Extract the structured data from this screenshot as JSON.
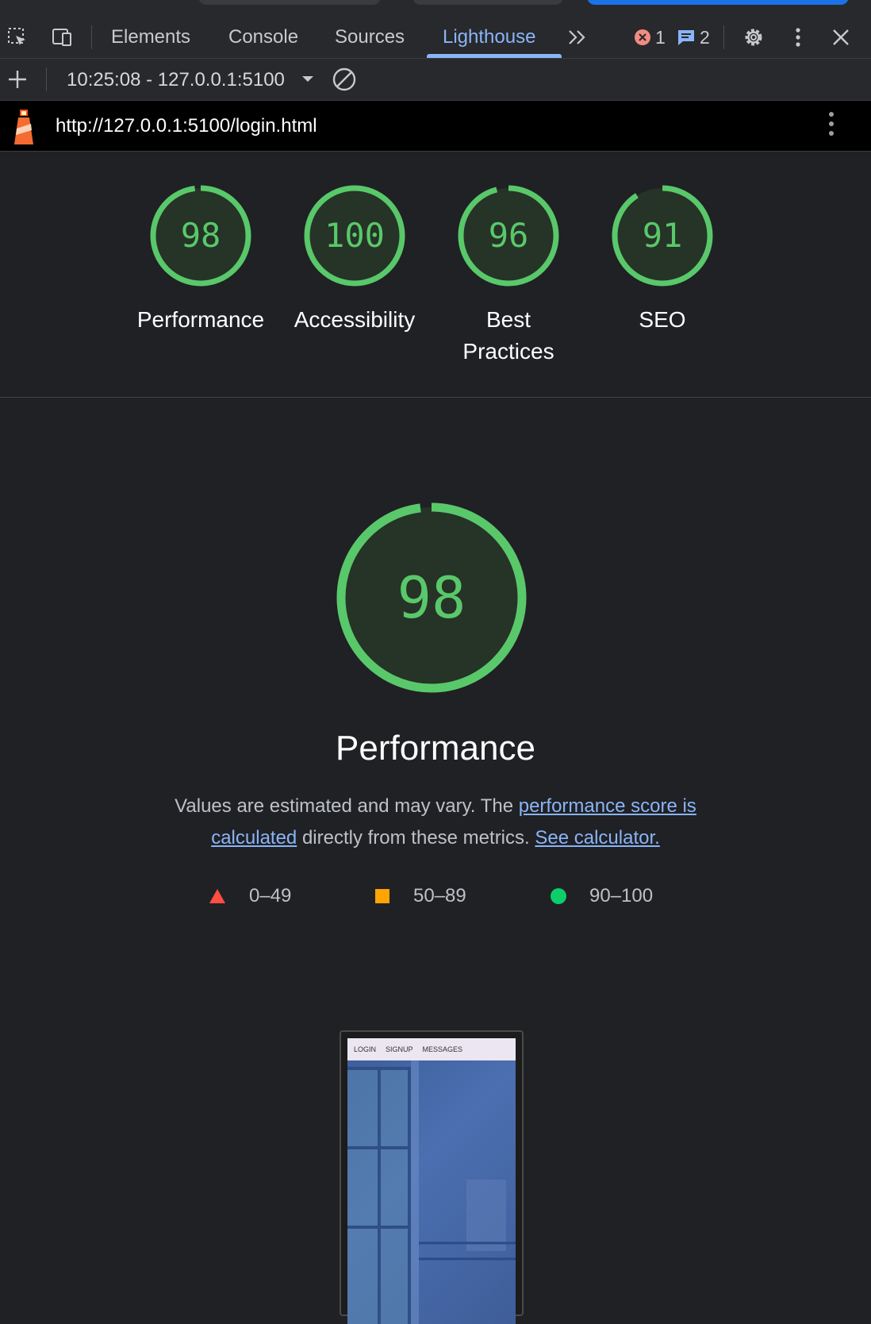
{
  "devtools": {
    "tabs": [
      {
        "label": "Elements"
      },
      {
        "label": "Console"
      },
      {
        "label": "Sources"
      },
      {
        "label": "Lighthouse"
      }
    ],
    "error_count": "1",
    "message_count": "2"
  },
  "report_bar": {
    "run_label": "10:25:08 - 127.0.0.1:5100"
  },
  "url_bar": {
    "url": "http://127.0.0.1:5100/login.html"
  },
  "categories": [
    {
      "score": "98",
      "label": "Performance",
      "value": 98
    },
    {
      "score": "100",
      "label": "Accessibility",
      "value": 100
    },
    {
      "score": "96",
      "label": "Best Practices",
      "value": 96
    },
    {
      "score": "91",
      "label": "SEO",
      "value": 91
    }
  ],
  "performance": {
    "score": "98",
    "value": 98,
    "title": "Performance",
    "desc_prefix": "Values are estimated and may vary. The ",
    "desc_link1": "performance score is calculated",
    "desc_middle": " directly from these metrics. ",
    "desc_link2": "See calculator."
  },
  "legend": [
    {
      "label": "0–49",
      "color": "#ff4e42",
      "shape": "triangle"
    },
    {
      "label": "50–89",
      "color": "#ffa400",
      "shape": "square"
    },
    {
      "label": "90–100",
      "color": "#0cce6b",
      "shape": "circle"
    }
  ],
  "thumbnail": {
    "nav": [
      "LOGIN",
      "SIGNUP",
      "MESSAGES"
    ]
  },
  "colors": {
    "pass": "#59c86a",
    "gauge_bg": "#263327",
    "link": "#8ab4f8"
  }
}
